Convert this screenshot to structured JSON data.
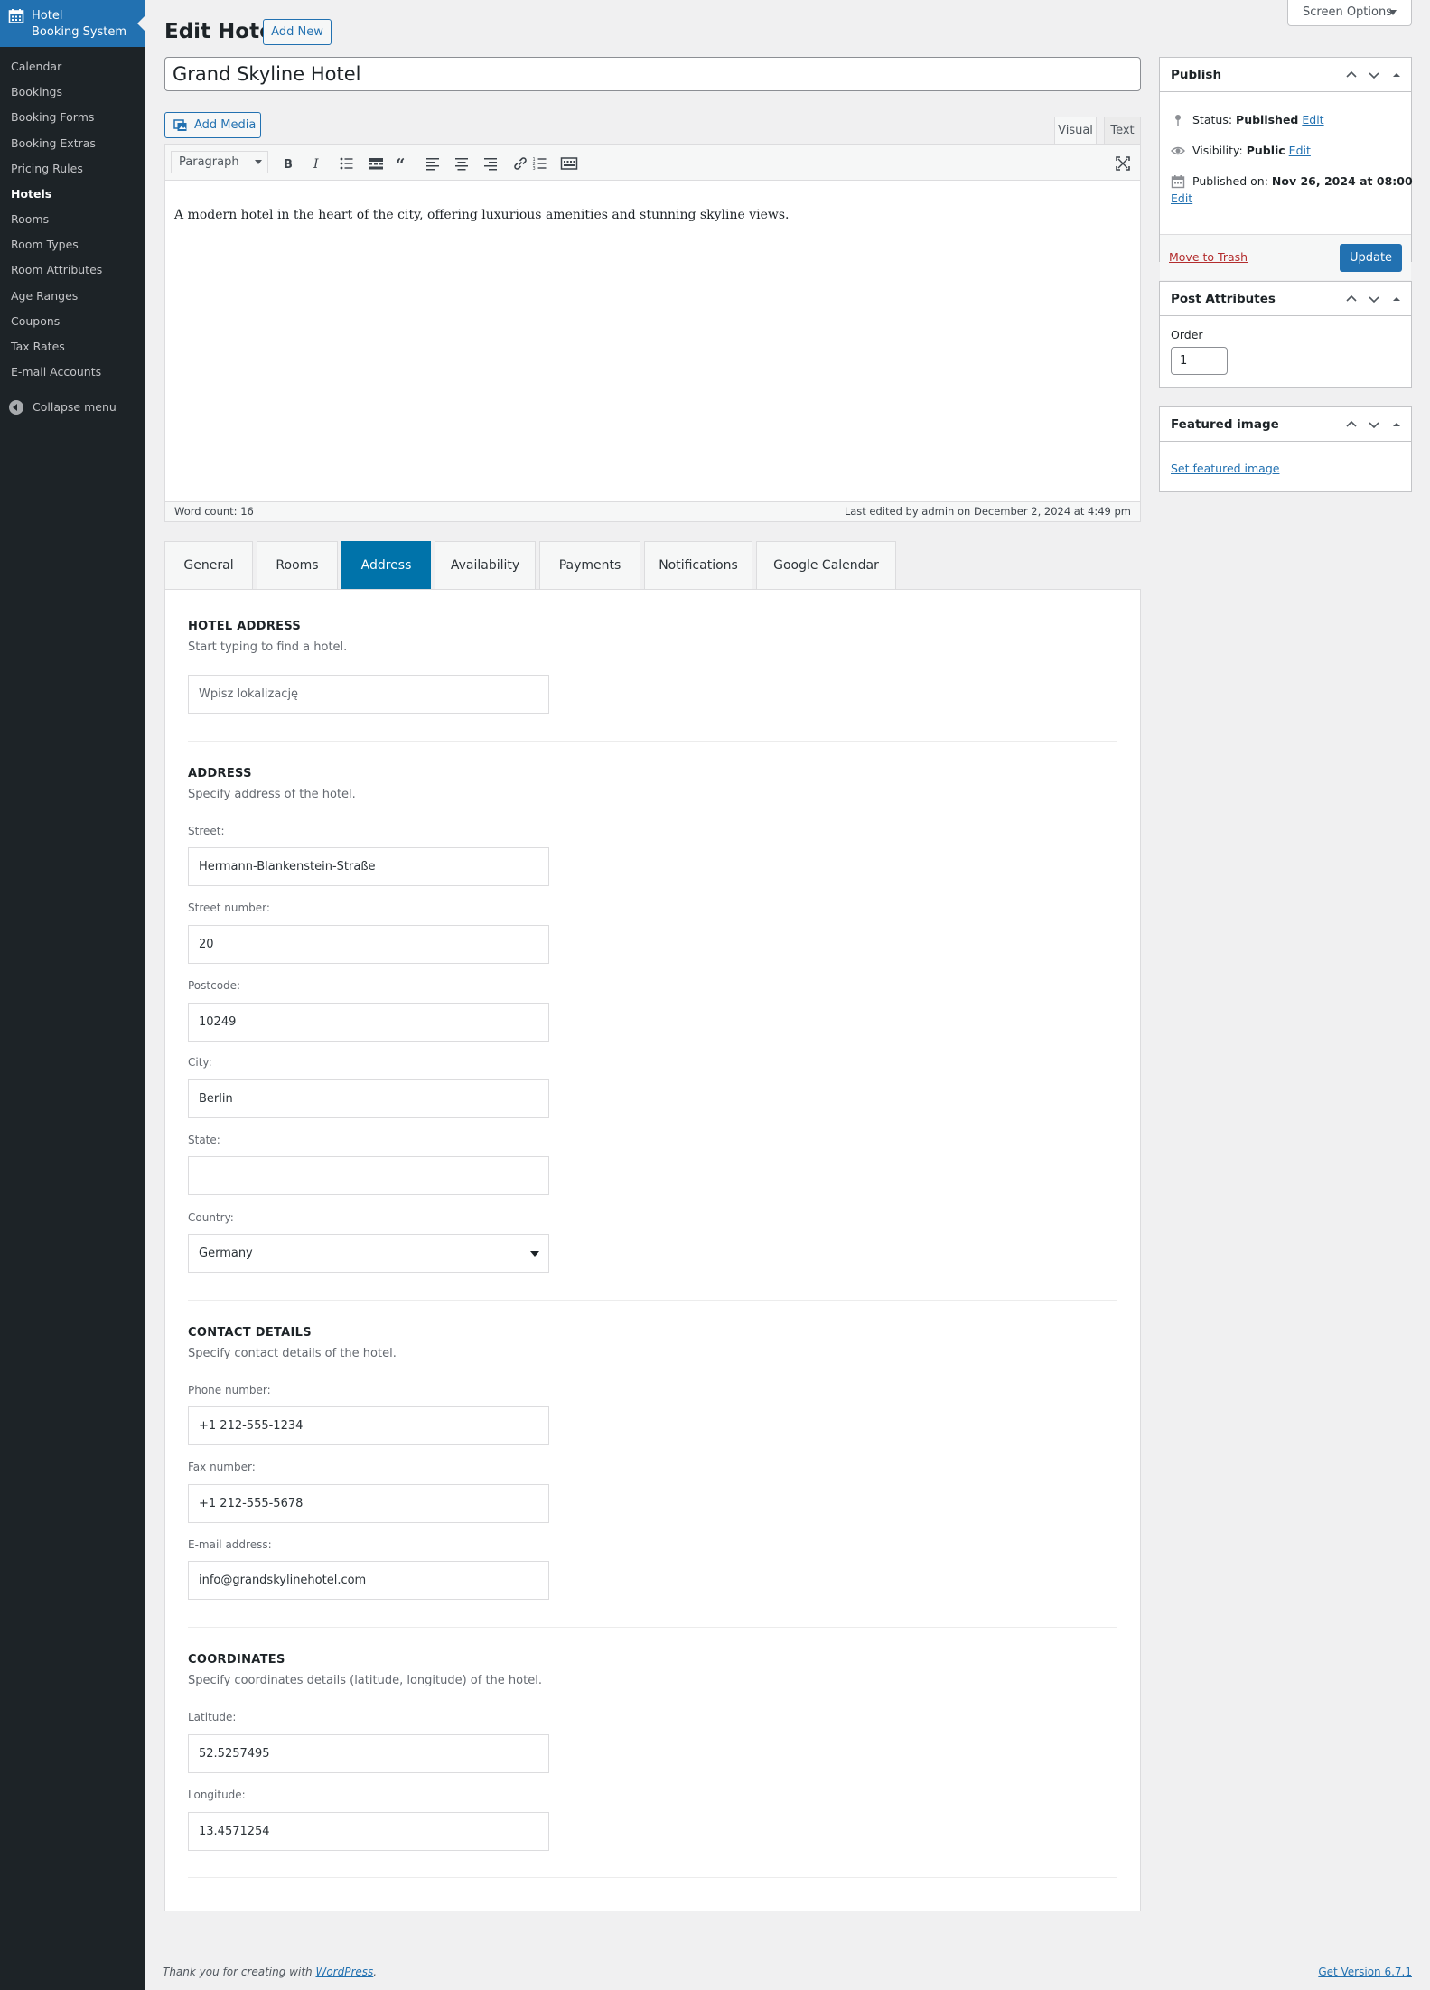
{
  "sidebar": {
    "brand_line1": "Hotel",
    "brand_line2": "Booking System",
    "items": [
      {
        "label": "Calendar"
      },
      {
        "label": "Bookings"
      },
      {
        "label": "Booking Forms"
      },
      {
        "label": "Booking Extras"
      },
      {
        "label": "Pricing Rules"
      },
      {
        "label": "Hotels",
        "active": true
      },
      {
        "label": "Rooms"
      },
      {
        "label": "Room Types"
      },
      {
        "label": "Room Attributes"
      },
      {
        "label": "Age Ranges"
      },
      {
        "label": "Coupons"
      },
      {
        "label": "Tax Rates"
      },
      {
        "label": "E-mail Accounts"
      }
    ],
    "collapse_label": "Collapse menu"
  },
  "header": {
    "title": "Edit Hotel",
    "add_new": "Add New",
    "screen_options": "Screen Options"
  },
  "post": {
    "title_value": "Grand Skyline Hotel"
  },
  "editor": {
    "add_media": "Add Media",
    "tab_visual": "Visual",
    "tab_text": "Text",
    "format": "Paragraph",
    "content": "A modern hotel in the heart of the city, offering luxurious amenities and stunning skyline views.",
    "word_count": "Word count: 16",
    "last_edited": "Last edited by admin on December 2, 2024 at 4:49 pm"
  },
  "tabs": [
    {
      "label": "General"
    },
    {
      "label": "Rooms"
    },
    {
      "label": "Address",
      "active": true
    },
    {
      "label": "Availability"
    },
    {
      "label": "Payments"
    },
    {
      "label": "Notifications"
    },
    {
      "label": "Google Calendar"
    }
  ],
  "address_panel": {
    "hotel_address": {
      "title": "HOTEL ADDRESS",
      "desc": "Start typing to find a hotel.",
      "search_placeholder": "Wpisz lokalizację"
    },
    "address": {
      "title": "ADDRESS",
      "desc": "Specify address of the hotel.",
      "street_label": "Street:",
      "street": "Hermann-Blankenstein-Straße",
      "street_number_label": "Street number:",
      "street_number": "20",
      "postcode_label": "Postcode:",
      "postcode": "10249",
      "city_label": "City:",
      "city": "Berlin",
      "state_label": "State:",
      "state": "",
      "country_label": "Country:",
      "country": "Germany"
    },
    "contact": {
      "title": "CONTACT DETAILS",
      "desc": "Specify contact details of the hotel.",
      "phone_label": "Phone number:",
      "phone": "+1 212-555-1234",
      "fax_label": "Fax number:",
      "fax": "+1 212-555-5678",
      "email_label": "E-mail address:",
      "email": "info@grandskylinehotel.com"
    },
    "coordinates": {
      "title": "COORDINATES",
      "desc": "Specify coordinates details (latitude, longitude) of the hotel.",
      "latitude_label": "Latitude:",
      "latitude": "52.5257495",
      "longitude_label": "Longitude:",
      "longitude": "13.4571254"
    }
  },
  "publish": {
    "title": "Publish",
    "status_label": "Status:",
    "status_value": "Published",
    "visibility_label": "Visibility:",
    "visibility_value": "Public",
    "published_label": "Published on:",
    "published_value": "Nov 26, 2024 at 08:00",
    "edit_link": "Edit",
    "trash": "Move to Trash",
    "update": "Update"
  },
  "post_attributes": {
    "title": "Post Attributes",
    "order_label": "Order",
    "order_value": "1"
  },
  "featured_image": {
    "title": "Featured image",
    "set_link": "Set featured image"
  },
  "footer": {
    "thanks_prefix": "Thank you for creating with ",
    "thanks_link": "WordPress",
    "thanks_suffix": ".",
    "version": "Get Version 6.7.1"
  },
  "colors": {
    "sidebar_bg": "#1d2327",
    "brand_bg": "#2271b1",
    "active_tab": "#0073aa",
    "link": "#2271b1",
    "danger": "#b32d2e"
  }
}
